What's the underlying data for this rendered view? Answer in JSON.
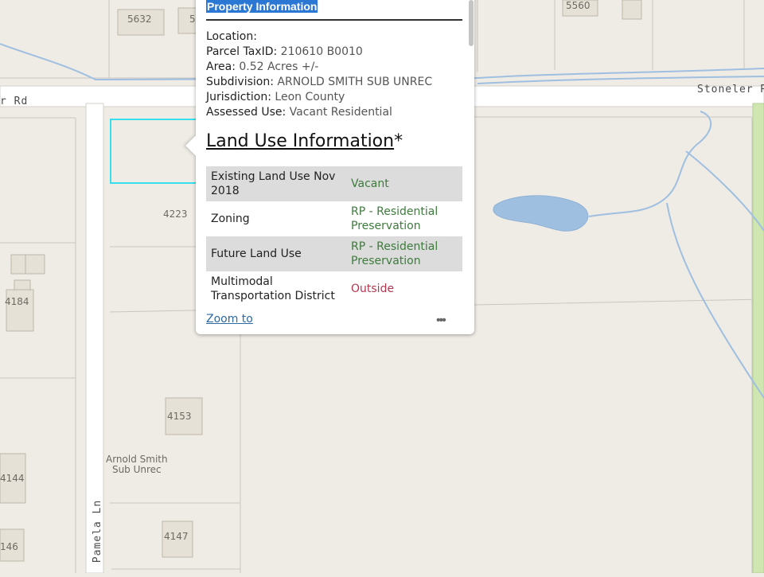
{
  "map": {
    "house_numbers": [
      "5632",
      "5",
      "5560",
      "4223",
      "4184",
      "4153",
      "4144",
      "4147",
      "146"
    ],
    "road_labels": [
      "r Rd",
      "Stoneler Ro",
      "Pamela Ln"
    ],
    "subdivision_label": [
      "Arnold Smith",
      "Sub Unrec"
    ],
    "colors": {
      "background": "#efece6",
      "parcel_line": "#c9c6bf",
      "road": "#ffffff",
      "water": "#9fbfe0",
      "highlight": "#33e0ec",
      "green_strip": "#cfe6b0"
    }
  },
  "popup": {
    "title": "Property Information",
    "fields": [
      {
        "label": "Location:",
        "value": ""
      },
      {
        "label": "Parcel TaxID:",
        "value": "210610 B0010"
      },
      {
        "label": "Area:",
        "value": "0.52 Acres +/-"
      },
      {
        "label": "Subdivision:",
        "value": "ARNOLD SMITH SUB UNREC"
      },
      {
        "label": "Jurisdiction:",
        "value": "Leon County"
      },
      {
        "label": "Assessed Use:",
        "value": "Vacant Residential"
      }
    ],
    "land_use_heading": "Land Use Information",
    "land_use_asterisk": "*",
    "table": [
      {
        "key": "Existing Land Use Nov 2018",
        "value": "Vacant"
      },
      {
        "key": "Zoning",
        "value": "RP - Residential Preservation"
      },
      {
        "key": "Future Land Use",
        "value": "RP - Residential Preservation"
      },
      {
        "key": "Multimodal Transportation District",
        "value": "Outside"
      }
    ],
    "zoom_label": "Zoom to",
    "more_icon": "•••"
  }
}
